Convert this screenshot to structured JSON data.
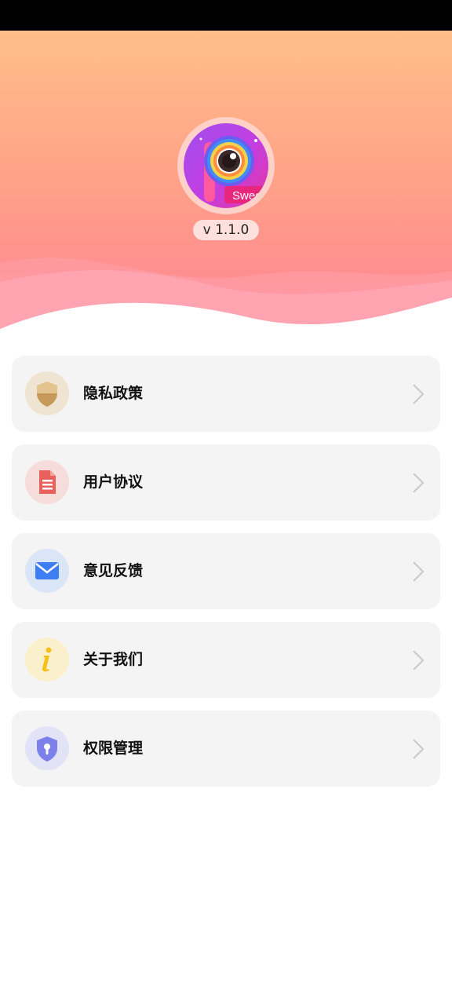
{
  "app": {
    "version": "v 1.1.0",
    "logo_text": "Swee"
  },
  "menu": {
    "items": [
      {
        "label": "隐私政策",
        "icon": "shield-icon",
        "icon_bg": "#efe3d2",
        "icon_color": "#c7995a"
      },
      {
        "label": "用户协议",
        "icon": "document-icon",
        "icon_bg": "#f7dcdc",
        "icon_color": "#e8615c"
      },
      {
        "label": "意见反馈",
        "icon": "mail-icon",
        "icon_bg": "#dbe5f8",
        "icon_color": "#3f7ef2"
      },
      {
        "label": "关于我们",
        "icon": "info-icon",
        "icon_bg": "#fbf0cc",
        "icon_color": "#f5bf1c"
      },
      {
        "label": "权限管理",
        "icon": "lock-shield-icon",
        "icon_bg": "#e2e3f7",
        "icon_color": "#7b80ea"
      }
    ]
  },
  "colors": {
    "header_top": "#ffbe8a",
    "header_bottom": "#ff909c",
    "card_bg": "#f4f4f4",
    "chevron": "#c8c8c8"
  }
}
